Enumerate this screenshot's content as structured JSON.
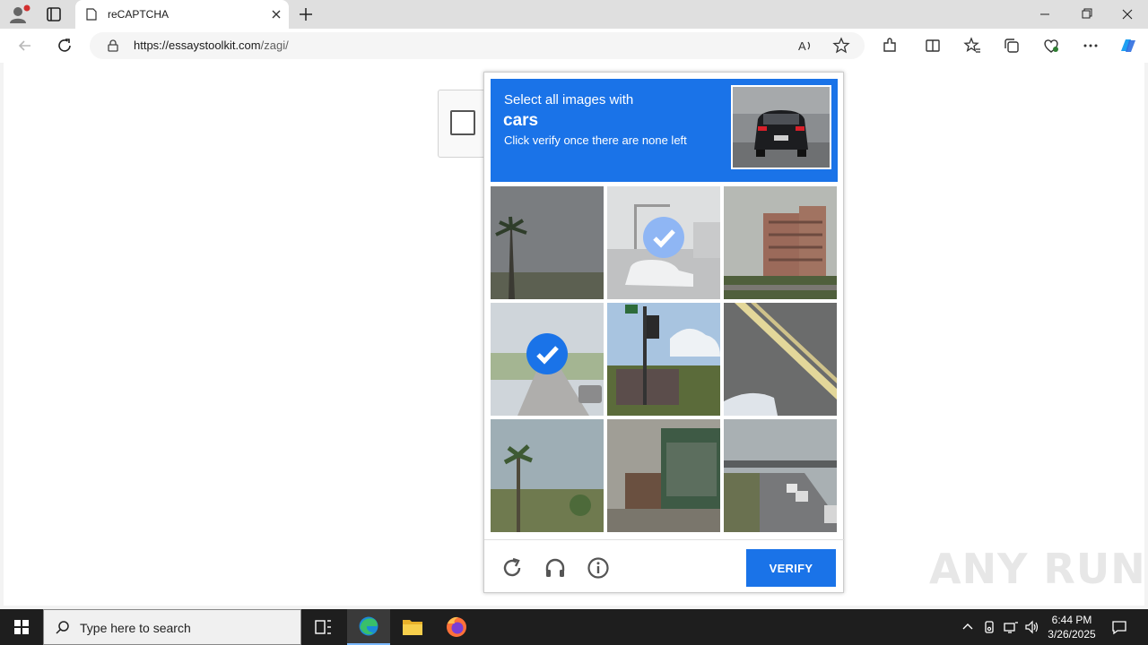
{
  "browser": {
    "tab_title": "reCAPTCHA",
    "url_host": "https://essaystoolkit.com",
    "url_path": "/zagi/"
  },
  "challenge": {
    "instruction_line1": "Select all images with",
    "keyword": "cars",
    "instruction_line3": "Click verify once there are none left",
    "verify_label": "VERIFY",
    "accent_color": "#1a73e8",
    "tiles": [
      {
        "scene": "palm tree against grey sky",
        "selected": false
      },
      {
        "scene": "street intersection with car",
        "selected": true
      },
      {
        "scene": "apartment building",
        "selected": false
      },
      {
        "scene": "rural road with car",
        "selected": true
      },
      {
        "scene": "traffic light and building",
        "selected": false
      },
      {
        "scene": "road with yellow lines",
        "selected": false
      },
      {
        "scene": "palm tree in field",
        "selected": false
      },
      {
        "scene": "house porch",
        "selected": false
      },
      {
        "scene": "highway with cars",
        "selected": false
      }
    ],
    "footer_icons": [
      "reload-icon",
      "audio-icon",
      "info-icon"
    ]
  },
  "watermark": "ANY RUN",
  "taskbar": {
    "search_placeholder": "Type here to search",
    "time": "6:44 PM",
    "date": "3/26/2025"
  }
}
